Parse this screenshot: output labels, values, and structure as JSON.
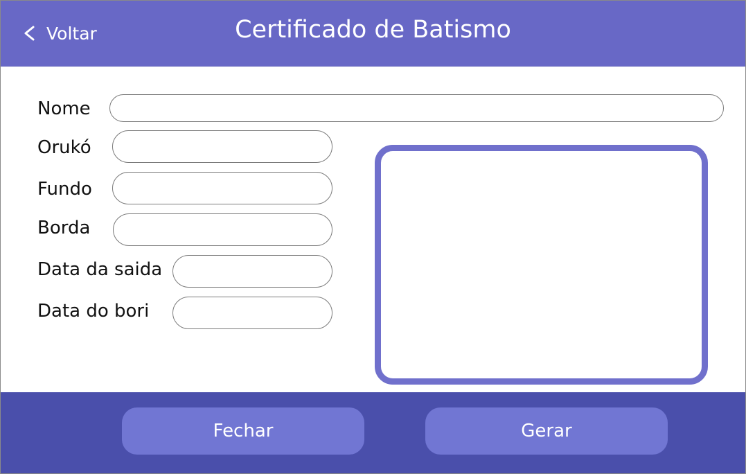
{
  "header": {
    "back_label": "Voltar",
    "title": "Certificado de Batismo"
  },
  "form": {
    "fields": [
      {
        "label": "Nome",
        "value": ""
      },
      {
        "label": "Orukó",
        "value": ""
      },
      {
        "label": "Fundo",
        "value": ""
      },
      {
        "label": "Borda",
        "value": ""
      },
      {
        "label": "Data da saida",
        "value": ""
      },
      {
        "label": "Data do bori",
        "value": ""
      }
    ]
  },
  "footer": {
    "close_label": "Fechar",
    "generate_label": "Gerar"
  },
  "colors": {
    "header": "#6868c6",
    "footer": "#4a4fab",
    "button": "#7176d3",
    "preview_border": "#7070cc"
  },
  "icons": {
    "back": "chevron-left-icon"
  }
}
